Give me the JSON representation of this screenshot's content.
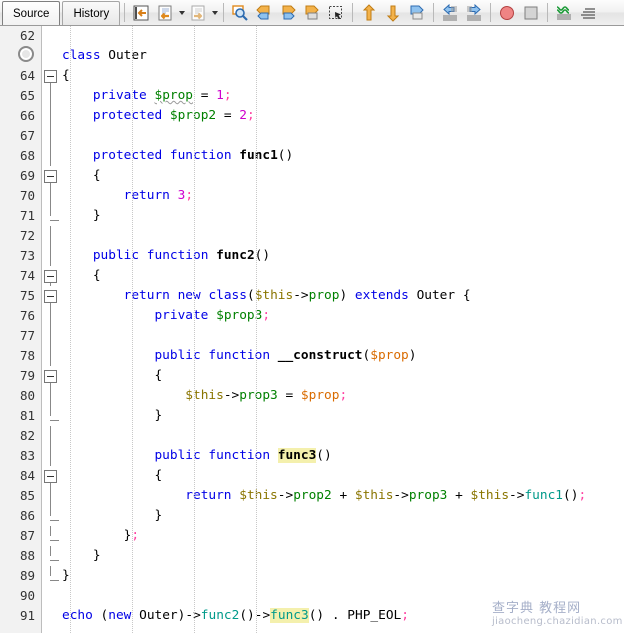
{
  "window": {
    "tabs": [
      {
        "label": "Source",
        "name": "tab-source",
        "active": true
      },
      {
        "label": "History",
        "name": "tab-history",
        "active": false
      }
    ]
  },
  "toolbar": {
    "buttons": [
      {
        "name": "last-edit-icon",
        "title": "Last Edit"
      },
      {
        "name": "back-document-icon",
        "title": "Back"
      },
      {
        "name": "forward-document-icon",
        "title": "Forward"
      },
      {
        "name": "find-selection-icon",
        "title": "Find Selection"
      },
      {
        "name": "previous-bookmark-icon",
        "title": "Previous Bookmark"
      },
      {
        "name": "next-bookmark-icon",
        "title": "Next Bookmark"
      },
      {
        "name": "toggle-bookmark-icon",
        "title": "Toggle Bookmark"
      },
      {
        "name": "toggle-rectangular-selection-icon",
        "title": "Rectangular Selection"
      },
      {
        "name": "shift-line-up-icon",
        "title": "Shift Line Up"
      },
      {
        "name": "shift-line-down-icon",
        "title": "Shift Line Down"
      },
      {
        "name": "comment-icon",
        "title": "Comment"
      },
      {
        "name": "shift-left-icon",
        "title": "Shift Left"
      },
      {
        "name": "shift-right-icon",
        "title": "Shift Right"
      },
      {
        "name": "record-macro-icon",
        "title": "Start Macro Recording"
      },
      {
        "name": "stop-macro-icon",
        "title": "Stop Macro Recording"
      },
      {
        "name": "diff-icon",
        "title": "Diff"
      },
      {
        "name": "format-icon",
        "title": "Format"
      }
    ],
    "dropdown_carets": 2
  },
  "editor": {
    "first_line": 62,
    "last_line": 91,
    "breakpoint_line": 63,
    "highlight_token": "func3",
    "colors": {
      "keyword": "#0000e6",
      "number": "#ce00ce",
      "semicolon": "#ff3fa0",
      "variable": "#0f9b0f",
      "this_var": "#8a7500",
      "param_var": "#d96b00",
      "method_call": "#009a8a",
      "function_name": "#000000",
      "occurrence_highlight": "#f4f0ad",
      "gutter_bg": "#f2f2f2"
    },
    "lines": [
      {
        "n": "62",
        "fold": "none",
        "text": ""
      },
      {
        "n": "◎",
        "fold": "none",
        "text": "class Outer",
        "marker": true
      },
      {
        "n": "64",
        "fold": "box-start",
        "text": "{"
      },
      {
        "n": "65",
        "fold": "line",
        "text": "    private $prop = 1;"
      },
      {
        "n": "66",
        "fold": "line",
        "text": "    protected $prop2 = 2;"
      },
      {
        "n": "67",
        "fold": "line",
        "text": ""
      },
      {
        "n": "68",
        "fold": "line",
        "text": "    protected function func1()"
      },
      {
        "n": "69",
        "fold": "box-start",
        "text": "    {"
      },
      {
        "n": "70",
        "fold": "line",
        "text": "        return 3;"
      },
      {
        "n": "71",
        "fold": "end",
        "text": "    }"
      },
      {
        "n": "72",
        "fold": "line",
        "text": ""
      },
      {
        "n": "73",
        "fold": "line",
        "text": "    public function func2()"
      },
      {
        "n": "74",
        "fold": "box-start",
        "text": "    {"
      },
      {
        "n": "75",
        "fold": "box-start",
        "text": "        return new class($this->prop) extends Outer {"
      },
      {
        "n": "76",
        "fold": "line",
        "text": "            private $prop3;"
      },
      {
        "n": "77",
        "fold": "line",
        "text": ""
      },
      {
        "n": "78",
        "fold": "line",
        "text": "            public function __construct($prop)"
      },
      {
        "n": "79",
        "fold": "box-start",
        "text": "            {"
      },
      {
        "n": "80",
        "fold": "line",
        "text": "                $this->prop3 = $prop;"
      },
      {
        "n": "81",
        "fold": "end",
        "text": "            }"
      },
      {
        "n": "82",
        "fold": "line",
        "text": ""
      },
      {
        "n": "83",
        "fold": "line",
        "text": "            public function func3()"
      },
      {
        "n": "84",
        "fold": "box-start",
        "text": "            {"
      },
      {
        "n": "85",
        "fold": "line",
        "text": "                return $this->prop2 + $this->prop3 + $this->func1();"
      },
      {
        "n": "86",
        "fold": "end",
        "text": "            }"
      },
      {
        "n": "87",
        "fold": "end",
        "text": "        };"
      },
      {
        "n": "88",
        "fold": "end",
        "text": "    }"
      },
      {
        "n": "89",
        "fold": "end",
        "text": "}"
      },
      {
        "n": "90",
        "fold": "none",
        "text": ""
      },
      {
        "n": "91",
        "fold": "none",
        "text": "echo (new Outer)->func2()->func3() . PHP_EOL;"
      }
    ]
  },
  "watermark": {
    "title": "查字典 教程网",
    "url": "jiaocheng.chazidian.com"
  }
}
